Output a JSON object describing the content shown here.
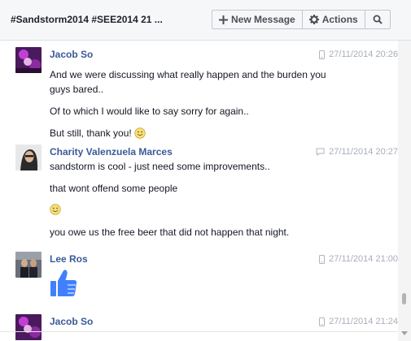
{
  "header": {
    "title": "#Sandstorm2014 #SEE2014  21 ...",
    "new_message_label": "New Message",
    "actions_label": "Actions",
    "new_message_icon": "plus-icon",
    "actions_icon": "gear-icon",
    "search_icon": "search-icon"
  },
  "messages": [
    {
      "sender": "Jacob So",
      "timestamp": "27/11/2014 20:26",
      "device_icon": "mobile-icon",
      "lines": [
        "And we were discussing what really happen and the burden you",
        "guys bared..",
        "Of to which I would like to say sorry for again..",
        "But still, thank you!"
      ]
    },
    {
      "sender": "Charity Valenzuela Marces",
      "timestamp": "27/11/2014 20:27",
      "device_icon": "chat-icon",
      "lines": [
        "sandstorm is cool - just need some improvements..",
        "that wont offend some people",
        "you owe us the free beer that did not happen that night."
      ]
    },
    {
      "sender": "Lee Ros",
      "timestamp": "27/11/2014 21:00",
      "device_icon": "mobile-icon",
      "attachment_icon": "thumbs-up-icon"
    },
    {
      "sender": "Jacob So",
      "timestamp": "27/11/2014 21:24",
      "device_icon": "mobile-icon"
    }
  ],
  "colors": {
    "link": "#3b5998",
    "meta": "#a8aeb8",
    "like": "#4080ff"
  }
}
